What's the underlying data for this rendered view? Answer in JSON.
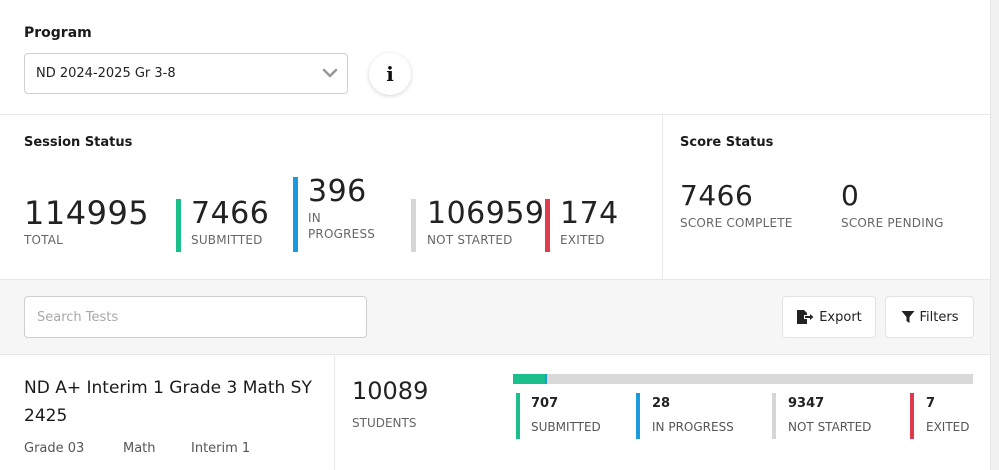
{
  "program": {
    "label": "Program",
    "selected": "ND 2024-2025 Gr 3-8",
    "info_icon": "info-icon"
  },
  "session_status": {
    "title": "Session Status",
    "total": {
      "value": "114995",
      "label": "TOTAL"
    },
    "submitted": {
      "value": "7466",
      "label": "SUBMITTED",
      "color": "#1bbf8c"
    },
    "in_progress": {
      "value": "396",
      "label_line1": "IN",
      "label_line2": "PROGRESS",
      "color": "#1a9be0"
    },
    "not_started": {
      "value": "106959",
      "label": "NOT STARTED",
      "color": "#d6d6d6"
    },
    "exited": {
      "value": "174",
      "label": "EXITED",
      "color": "#e03a4e"
    }
  },
  "score_status": {
    "title": "Score Status",
    "complete": {
      "value": "7466",
      "label": "SCORE COMPLETE"
    },
    "pending": {
      "value": "0",
      "label": "SCORE PENDING"
    }
  },
  "toolbar": {
    "search_placeholder": "Search Tests",
    "export_label": "Export",
    "export_icon": "export-icon",
    "filters_label": "Filters",
    "filters_icon": "filter-icon"
  },
  "tests": [
    {
      "title": "ND A+ Interim 1 Grade 3 Math SY 2425",
      "grade": "Grade 03",
      "subject": "Math",
      "assessment": "Interim 1",
      "students": "10089",
      "students_label": "STUDENTS",
      "progress_submitted_fraction": 0.07,
      "progress_in_progress_fraction": 0.003,
      "stats": {
        "submitted": {
          "value": "707",
          "label": "SUBMITTED"
        },
        "in_progress": {
          "value": "28",
          "label": "IN PROGRESS"
        },
        "not_started": {
          "value": "9347",
          "label": "NOT STARTED"
        },
        "exited": {
          "value": "7",
          "label": "EXITED"
        }
      }
    }
  ]
}
